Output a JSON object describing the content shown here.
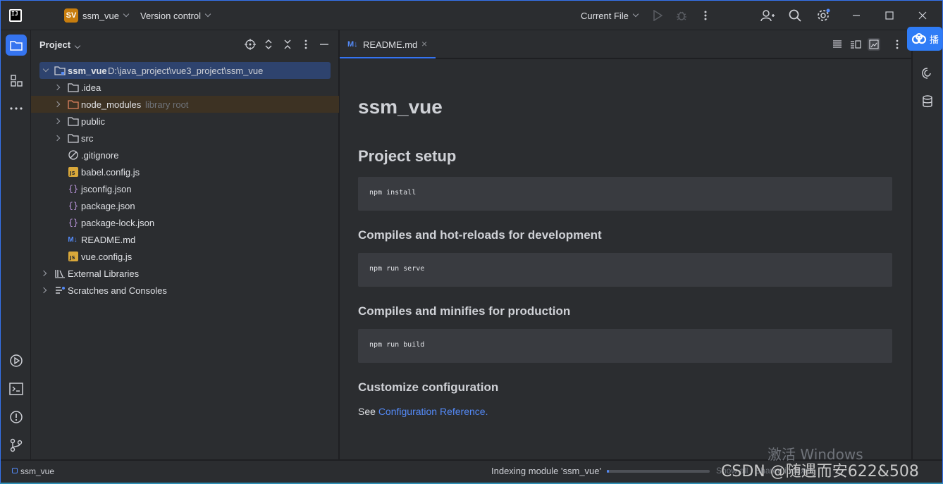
{
  "titlebar": {
    "app_logo": "IJ",
    "project_badge": "SV",
    "project_name": "ssm_vue",
    "version_control": "Version control",
    "run_config": "Current File"
  },
  "project_panel": {
    "title": "Project",
    "tree": [
      {
        "label": "ssm_vue",
        "path": "D:\\java_project\\vue3_project\\ssm_vue",
        "icon": "module-folder-icon",
        "expanded": true
      },
      {
        "label": ".idea",
        "icon": "folder-icon"
      },
      {
        "label": "node_modules",
        "hint": "library root",
        "icon": "folder-excluded-icon"
      },
      {
        "label": "public",
        "icon": "folder-icon"
      },
      {
        "label": "src",
        "icon": "folder-icon"
      },
      {
        "label": ".gitignore",
        "icon": "ignore-file-icon"
      },
      {
        "label": "babel.config.js",
        "icon": "js-file-icon"
      },
      {
        "label": "jsconfig.json",
        "icon": "json-file-icon"
      },
      {
        "label": "package.json",
        "icon": "json-file-icon"
      },
      {
        "label": "package-lock.json",
        "icon": "json-file-icon"
      },
      {
        "label": "README.md",
        "icon": "markdown-file-icon"
      },
      {
        "label": "vue.config.js",
        "icon": "js-file-icon"
      },
      {
        "label": "External Libraries",
        "icon": "libraries-icon"
      },
      {
        "label": "Scratches and Consoles",
        "icon": "scratches-icon"
      }
    ]
  },
  "editor": {
    "tab": {
      "md_badge": "M↓",
      "label": "README.md",
      "close": "×"
    },
    "markdown": {
      "h1": "ssm_vue",
      "setup_heading": "Project setup",
      "setup_code": "npm install",
      "dev_heading": "Compiles and hot-reloads for development",
      "dev_code": "npm run serve",
      "prod_heading": "Compiles and minifies for production",
      "prod_code": "npm run build",
      "config_heading": "Customize configuration",
      "config_prefix": "See ",
      "config_link": "Configuration Reference",
      "config_suffix": "."
    }
  },
  "statusbar": {
    "project": "ssm_vue",
    "indexing": "Indexing module 'ssm_vue'",
    "progress": 0.02,
    "extra": "Show all | Shared indexes"
  },
  "overlays": {
    "windows_watermark": "激活 Windows",
    "csdn_watermark": "CSDN @随遇而安622&508",
    "baidu_char": "播"
  },
  "colors": {
    "accent": "#3574f0",
    "link": "#548af7",
    "project_badge": "#c77d0e",
    "selection": "#2e436e"
  }
}
